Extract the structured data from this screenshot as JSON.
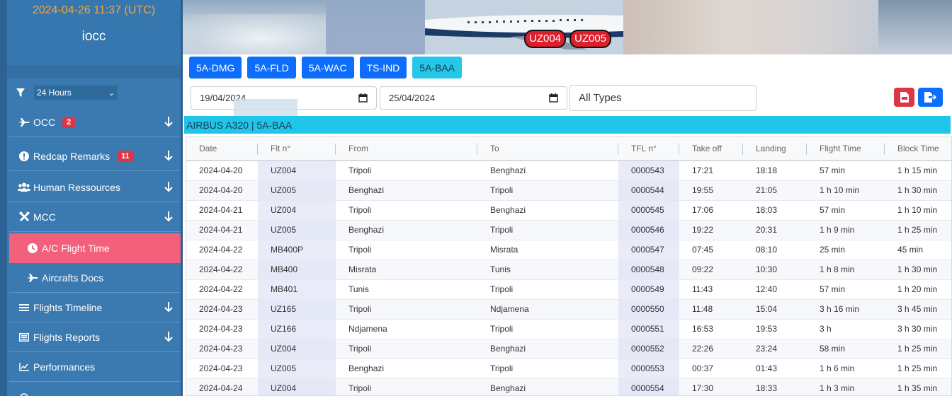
{
  "sidebar": {
    "datetime": "2024-04-26 11:37 (UTC)",
    "user": "iocc",
    "hours_filter": "24 Hours",
    "items": [
      {
        "label": "OCC",
        "badge": "2"
      },
      {
        "label": "Redcap Remarks",
        "badge": "11"
      },
      {
        "label": "Human Ressources"
      },
      {
        "label": "MCC"
      },
      {
        "label": "A/C Flight Time"
      },
      {
        "label": "Aircrafts Docs"
      },
      {
        "label": "Flights Timeline"
      },
      {
        "label": "Flights Reports"
      },
      {
        "label": "Performances"
      }
    ]
  },
  "banner": {
    "badges": [
      "UZ004",
      "UZ005"
    ]
  },
  "aircraft_tabs": [
    "5A-DMG",
    "5A-FLD",
    "5A-WAC",
    "TS-IND",
    "5A-BAA"
  ],
  "filters": {
    "date_from": "19/04/2024",
    "date_to": "25/04/2024",
    "type": "All Types"
  },
  "aircraft_title": "AIRBUS A320 | 5A-BAA",
  "table": {
    "headers": [
      "Date",
      "Flt n°",
      "From",
      "To",
      "TFL n°",
      "Take off",
      "Landing",
      "Flight Time",
      "Block Time"
    ],
    "rows": [
      [
        "2024-04-20",
        "UZ004",
        "Tripoli",
        "Benghazi",
        "0000543",
        "17:21",
        "18:18",
        "57 min",
        "1 h 15 min"
      ],
      [
        "2024-04-20",
        "UZ005",
        "Benghazi",
        "Tripoli",
        "0000544",
        "19:55",
        "21:05",
        "1 h 10 min",
        "1 h 30 min"
      ],
      [
        "2024-04-21",
        "UZ004",
        "Tripoli",
        "Benghazi",
        "0000545",
        "17:06",
        "18:03",
        "57 min",
        "1 h 10 min"
      ],
      [
        "2024-04-21",
        "UZ005",
        "Benghazi",
        "Tripoli",
        "0000546",
        "19:22",
        "20:31",
        "1 h 9 min",
        "1 h 25 min"
      ],
      [
        "2024-04-22",
        "MB400P",
        "Tripoli",
        "Misrata",
        "0000547",
        "07:45",
        "08:10",
        "25 min",
        "45 min"
      ],
      [
        "2024-04-22",
        "MB400",
        "Misrata",
        "Tunis",
        "0000548",
        "09:22",
        "10:30",
        "1 h 8 min",
        "1 h 30 min"
      ],
      [
        "2024-04-22",
        "MB401",
        "Tunis",
        "Tripoli",
        "0000549",
        "11:43",
        "12:40",
        "57 min",
        "1 h 20 min"
      ],
      [
        "2024-04-23",
        "UZ165",
        "Tripoli",
        "Ndjamena",
        "0000550",
        "11:48",
        "15:04",
        "3 h 16 min",
        "3 h 45 min"
      ],
      [
        "2024-04-23",
        "UZ166",
        "Ndjamena",
        "Tripoli",
        "0000551",
        "16:53",
        "19:53",
        "3 h",
        "3 h 30 min"
      ],
      [
        "2024-04-23",
        "UZ004",
        "Tripoli",
        "Benghazi",
        "0000552",
        "22:26",
        "23:24",
        "58 min",
        "1 h 25 min"
      ],
      [
        "2024-04-23",
        "UZ005",
        "Benghazi",
        "Tripoli",
        "0000553",
        "00:37",
        "01:43",
        "1 h 6 min",
        "1 h 25 min"
      ],
      [
        "2024-04-24",
        "UZ004",
        "Tripoli",
        "Benghazi",
        "0000554",
        "17:30",
        "18:33",
        "1 h 3 min",
        "1 h 35 min"
      ]
    ]
  }
}
